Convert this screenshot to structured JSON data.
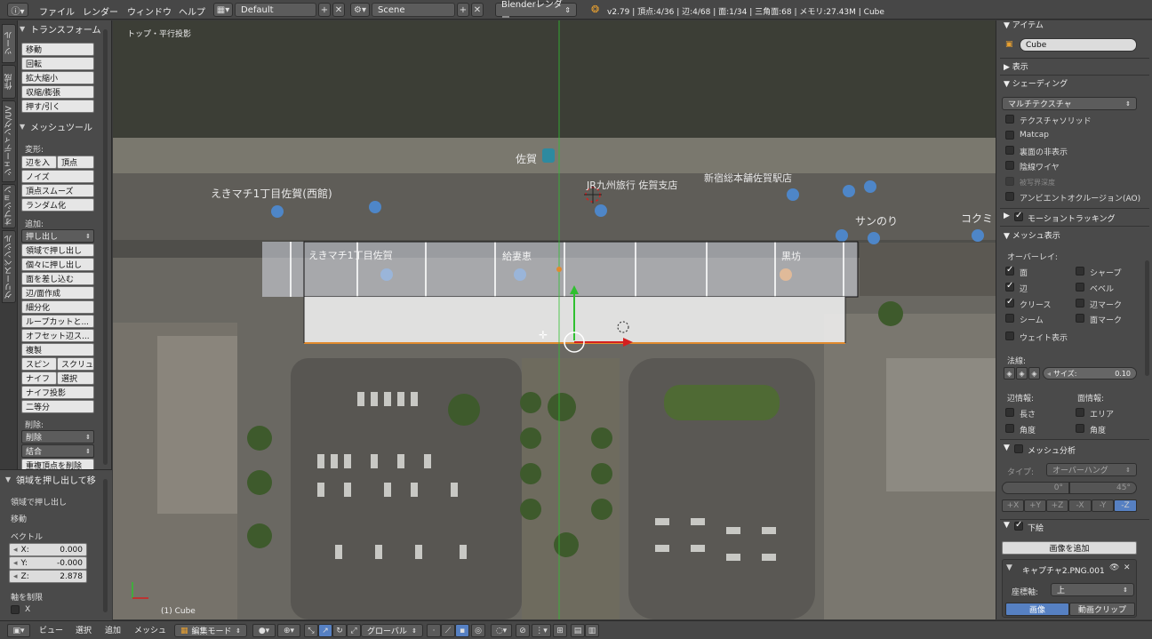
{
  "topbar": {
    "info_icon": "info-icon",
    "menus": [
      "ファイル",
      "レンダー",
      "ウィンドウ",
      "ヘルプ"
    ],
    "layout_name": "Default",
    "scene_name": "Scene",
    "render_engine": "Blenderレンダー",
    "stats": "v2.79 | 頂点:4/36 | 辺:4/68 | 面:1/34 | 三角面:68 | メモリ:27.43M | Cube"
  },
  "left_tabs": [
    "ツール",
    "作成",
    "シェーディング/UV",
    "オプション",
    "グリースペンシル"
  ],
  "tools": {
    "transform_header": "トランスフォーム",
    "transform_buttons": [
      "移動",
      "回転",
      "拡大縮小",
      "収縮/膨張",
      "押す/引く"
    ],
    "mesh_tools_header": "メッシュツール",
    "deform_label": "変形:",
    "deform_buttons": [
      "辺を入",
      "頂点",
      "ノイズ",
      "頂点スムーズ",
      "ランダム化"
    ],
    "add_label": "追加:",
    "extrude_dropdown": "押し出し",
    "add_buttons": [
      "領域で押し出し",
      "個々に押し出し",
      "面を差し込む",
      "辺/面作成",
      "細分化",
      "ループカットと...",
      "オフセット辺ス...",
      "複製"
    ],
    "spin_buttons": [
      "スピン",
      "スクリュ"
    ],
    "knife_buttons": [
      "ナイフ",
      "選択"
    ],
    "more_buttons": [
      "ナイフ投影",
      "二等分"
    ],
    "delete_label": "削除:",
    "delete_dropdown": "削除",
    "merge_dropdown": "結合",
    "remove_doubles": "重複頂点を削除"
  },
  "operator": {
    "header": "領域を押し出して移",
    "line1": "領域で押し出し",
    "line2": "移動",
    "vector_label": "ベクトル",
    "x_label": "X:",
    "x": "0.000",
    "y_label": "Y:",
    "y": "-0.000",
    "z_label": "Z:",
    "z": "2.878",
    "axis_constraint_label": "軸を制限",
    "axis_x": "X"
  },
  "viewport": {
    "view_label": "トップ・平行投影",
    "object_label": "(1) Cube",
    "map_labels": [
      "佐賀",
      "えきマチ1丁目佐賀(西館)",
      "JR九州旅行 佐賀支店",
      "新宿総本舗佐賀駅店",
      "えきマチ1丁目佐賀",
      "給妻恵",
      "黒坊",
      "サンのり",
      "コクミ"
    ]
  },
  "properties": {
    "item_header": "アイテム",
    "object_name": "Cube",
    "display_header": "表示",
    "shading_header": "シェーディング",
    "shading_mode": "マルチテクスチャ",
    "shading_options": [
      {
        "label": "テクスチャソリッド",
        "checked": false
      },
      {
        "label": "Matcap",
        "checked": false
      },
      {
        "label": "裏面の非表示",
        "checked": false
      },
      {
        "label": "陰線ワイヤ",
        "checked": false
      },
      {
        "label": "被写界深度",
        "checked": false
      },
      {
        "label": "アンビエントオクルージョン(AO)",
        "checked": false
      }
    ],
    "motion_tracking_header": "モーショントラッキング",
    "mesh_display_header": "メッシュ表示",
    "overlay_label": "オーバーレイ:",
    "overlay_left": [
      {
        "label": "面",
        "checked": true
      },
      {
        "label": "辺",
        "checked": true
      },
      {
        "label": "クリース",
        "checked": true
      },
      {
        "label": "シーム",
        "checked": false
      }
    ],
    "overlay_right": [
      {
        "label": "シャープ",
        "checked": false
      },
      {
        "label": "ベベル",
        "checked": false
      },
      {
        "label": "辺マーク",
        "checked": false
      },
      {
        "label": "面マーク",
        "checked": false
      }
    ],
    "weight_display": "ウェイト表示",
    "normals_label": "法線:",
    "size_label": "サイズ:",
    "size_value": "0.10",
    "edge_info_label": "辺情報:",
    "face_info_label": "面情報:",
    "edge_info": [
      "長さ",
      "角度"
    ],
    "face_info": [
      "エリア",
      "角度"
    ],
    "mesh_analysis_header": "メッシュ分析",
    "type_label": "タイプ:",
    "type_value": "オーバーハング",
    "angle_min": "0°",
    "angle_max": "45°",
    "axis_buttons": [
      "+X",
      "+Y",
      "+Z",
      "-X",
      "-Y",
      "-Z"
    ],
    "background_header": "下絵",
    "add_image": "画像を追加",
    "image_name": "キャプチャ2.PNG.001",
    "axis_label": "座標軸:",
    "axis_value": "上",
    "image_tab": "画像",
    "movie_tab": "動画クリップ"
  },
  "bottombar": {
    "menus": [
      "ビュー",
      "選択",
      "追加",
      "メッシュ"
    ],
    "mode": "編集モード",
    "orientation": "グローバル"
  },
  "colors": {
    "accent_blue": "#5680c2",
    "x_axis": "#d42020",
    "y_axis": "#30c030",
    "selected_edge": "#e08a2e"
  }
}
